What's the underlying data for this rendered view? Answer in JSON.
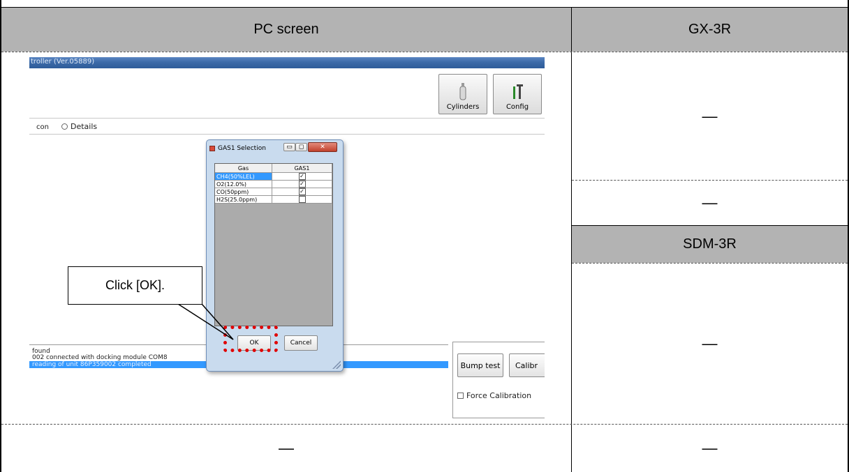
{
  "table": {
    "header_pc": "PC screen",
    "header_gx": "GX-3R",
    "header_sdm": "SDM-3R",
    "dash": "—"
  },
  "app": {
    "title": "troller (Ver.05889)",
    "toolbar": {
      "cylinders": "Cylinders",
      "config": "Config"
    },
    "radio_left": "con",
    "radio_details": "Details",
    "log": {
      "line1": "found",
      "line2": "002 connected with docking module COM8",
      "line3": "reading of unit 86P359002 completed"
    },
    "bump_test": "Bump test",
    "calibr": "Calibr",
    "force_calibration": "Force Calibration"
  },
  "dialog": {
    "title": "GAS1 Selection",
    "col_gas": "Gas",
    "col_gas1": "GAS1",
    "rows": [
      {
        "gas": "CH4(50%LEL)",
        "checked": "✓"
      },
      {
        "gas": "O2(12.0%)",
        "checked": "✓"
      },
      {
        "gas": "CO(50ppm)",
        "checked": "✓"
      },
      {
        "gas": "H2S(25.0ppm)",
        "checked": ""
      }
    ],
    "ok": "OK",
    "cancel": "Cancel"
  },
  "callout": {
    "text": "Click [OK]."
  },
  "colors": {
    "header_bg": "#b3b3b3",
    "highlight": "#3399ff",
    "callout_dots": "#e00000"
  }
}
